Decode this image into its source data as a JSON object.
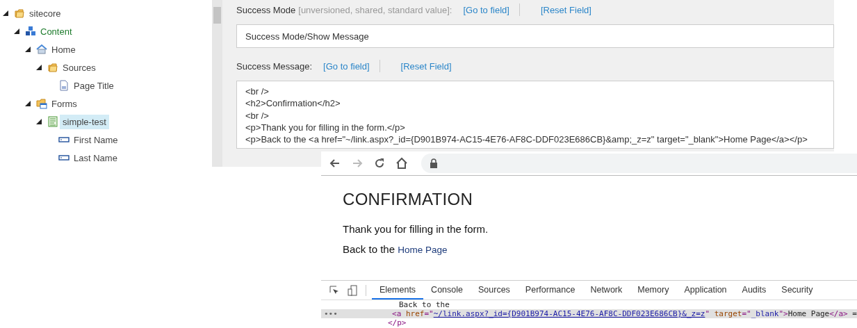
{
  "tree": [
    {
      "label": "sitecore",
      "kind": "folder",
      "expanded": true,
      "selected": false,
      "children": [
        {
          "label": "Content",
          "kind": "cubes",
          "expanded": true,
          "selected": false,
          "accent": true,
          "children": [
            {
              "label": "Home",
              "kind": "home",
              "expanded": true,
              "selected": false,
              "children": [
                {
                  "label": "Sources",
                  "kind": "folder",
                  "expanded": true,
                  "selected": false,
                  "children": [
                    {
                      "label": "Page Title",
                      "kind": "document",
                      "selected": false
                    }
                  ]
                }
              ]
            },
            {
              "label": "Forms",
              "kind": "form-folder",
              "expanded": true,
              "selected": false,
              "children": [
                {
                  "label": "simple-test",
                  "kind": "form",
                  "expanded": true,
                  "selected": true,
                  "children": [
                    {
                      "label": "First Name",
                      "kind": "field",
                      "selected": false
                    },
                    {
                      "label": "Last Name",
                      "kind": "field",
                      "selected": false
                    }
                  ]
                }
              ]
            }
          ]
        }
      ]
    }
  ],
  "editor": {
    "fields": [
      {
        "label": "Success Mode",
        "meta": "[unversioned, shared, standard value]:",
        "links": [
          "[Go to field]",
          "[Reset Field]"
        ],
        "kind": "single",
        "lines": [
          "Success Mode/Show Message"
        ]
      },
      {
        "label": "Success Message:",
        "links": [
          "[Go to field]",
          "[Reset Field]"
        ],
        "kind": "multi",
        "lines": [
          "<br />",
          "<h2>Confirmation</h2>",
          "<br />",
          "<p>Thank you for filling in the form.</p>",
          "<p>Back to the <a href=\"~/link.aspx?_id={D901B974-AC15-4E76-AF8C-DDF023E686CB}&amp;_z=z\" target=\"_blank\">Home Page</a></p>"
        ]
      }
    ]
  },
  "browser": {
    "heading": "CONFIRMATION",
    "paragraph": "Thank you for filling in the form.",
    "link_lead": "Back to the",
    "link_text": "Home Page",
    "devtools": {
      "tabs": [
        {
          "label": "Elements",
          "selected": true
        },
        {
          "label": "Console",
          "selected": false
        },
        {
          "label": "Sources",
          "selected": false
        },
        {
          "label": "Performance",
          "selected": false
        },
        {
          "label": "Network",
          "selected": false
        },
        {
          "label": "Memory",
          "selected": false
        },
        {
          "label": "Application",
          "selected": false
        },
        {
          "label": "Audits",
          "selected": false
        },
        {
          "label": "Security",
          "selected": false
        }
      ],
      "lines": [
        {
          "kind": "text",
          "text": "Back to the",
          "highlighted": false
        },
        {
          "kind": "element",
          "highlighted": true,
          "gutter": "•••",
          "parts": [
            {
              "kind": "tag",
              "text": "<a "
            },
            {
              "kind": "attr",
              "text": "href"
            },
            {
              "kind": "tag",
              "text": "=\""
            },
            {
              "kind": "link",
              "text": "~/link.aspx?_id={D901B974-AC15-4E76-AF8C-DDF023E686CB}&_z=z"
            },
            {
              "kind": "tag",
              "text": "\" "
            },
            {
              "kind": "attr",
              "text": "target"
            },
            {
              "kind": "tag",
              "text": "=\""
            },
            {
              "kind": "value",
              "text": "_blank"
            },
            {
              "kind": "tag",
              "text": "\">"
            },
            {
              "kind": "text",
              "text": "Home Page"
            },
            {
              "kind": "tag",
              "text": "</a>"
            },
            {
              "kind": "text",
              "text": " ="
            }
          ]
        },
        {
          "kind": "close",
          "text": "</p>",
          "highlighted": false
        }
      ]
    }
  }
}
